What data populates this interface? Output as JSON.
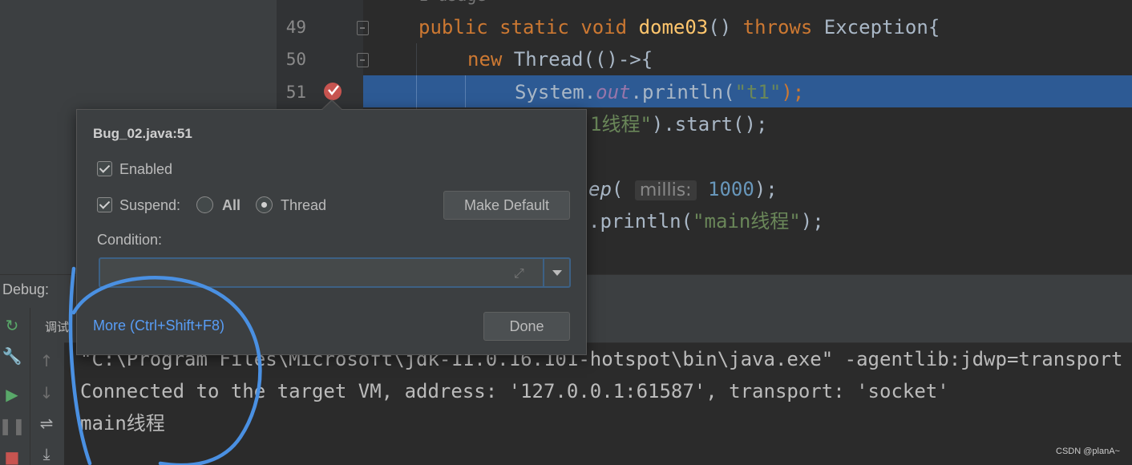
{
  "editor": {
    "lines": [
      {
        "number": "49",
        "parts": [
          {
            "t": "public ",
            "c": "kw"
          },
          {
            "t": "static ",
            "c": "kw"
          },
          {
            "t": "void ",
            "c": "kw"
          },
          {
            "t": "dome03",
            "c": "fn"
          },
          {
            "t": "() ",
            "c": ""
          },
          {
            "t": "throws ",
            "c": "kw"
          },
          {
            "t": "Exception{",
            "c": ""
          }
        ]
      },
      {
        "number": "50",
        "parts": [
          {
            "t": "new ",
            "c": "kw"
          },
          {
            "t": "Thread(()->{",
            "c": ""
          }
        ]
      },
      {
        "number": "51",
        "parts": [
          {
            "t": "System.",
            "c": ""
          },
          {
            "t": "out",
            "c": "fld"
          },
          {
            "t": ".println(",
            "c": ""
          },
          {
            "t": "\"t1\"",
            "c": "str"
          },
          {
            "t": ");",
            "c": "kw"
          }
        ]
      },
      {
        "number": "",
        "parts": [
          {
            "t": "1线程\"",
            "c": "str"
          },
          {
            "t": ").start();",
            "c": ""
          }
        ]
      },
      {
        "number": "",
        "parts": [
          {
            "t": "ep",
            "c": "it"
          },
          {
            "t": "( ",
            "c": ""
          },
          {
            "t": "millis:",
            "c": "hint"
          },
          {
            "t": " ",
            "c": ""
          },
          {
            "t": "1000",
            "c": "num"
          },
          {
            "t": ");",
            "c": ""
          }
        ]
      },
      {
        "number": "",
        "parts": [
          {
            "t": ".println(",
            "c": ""
          },
          {
            "t": "\"main线程\"",
            "c": "str"
          },
          {
            "t": ");",
            "c": ""
          }
        ]
      }
    ]
  },
  "popup": {
    "title": "Bug_02.java:51",
    "enabled_label": "Enabled",
    "suspend_label": "Suspend:",
    "all_label": "All",
    "thread_label": "Thread",
    "make_default_label": "Make Default",
    "condition_label": "Condition:",
    "condition_value": "",
    "more_label": "More (Ctrl+Shift+F8)",
    "done_label": "Done"
  },
  "debug": {
    "label": "Debug:",
    "tab_label": "调试"
  },
  "console": {
    "lines": [
      "\"C:\\Program Files\\Microsoft\\jdk-11.0.16.101-hotspot\\bin\\java.exe\" -agentlib:jdwp=transport",
      "Connected to the target VM, address: '127.0.0.1:61587', transport: 'socket'",
      "main线程"
    ]
  },
  "watermark": "CSDN @planA~",
  "colors": {
    "accent": "#589df6",
    "highlight_row": "#2d5a94",
    "annotation_circle": "#4a90e2",
    "breakpoint": "#c75450"
  }
}
